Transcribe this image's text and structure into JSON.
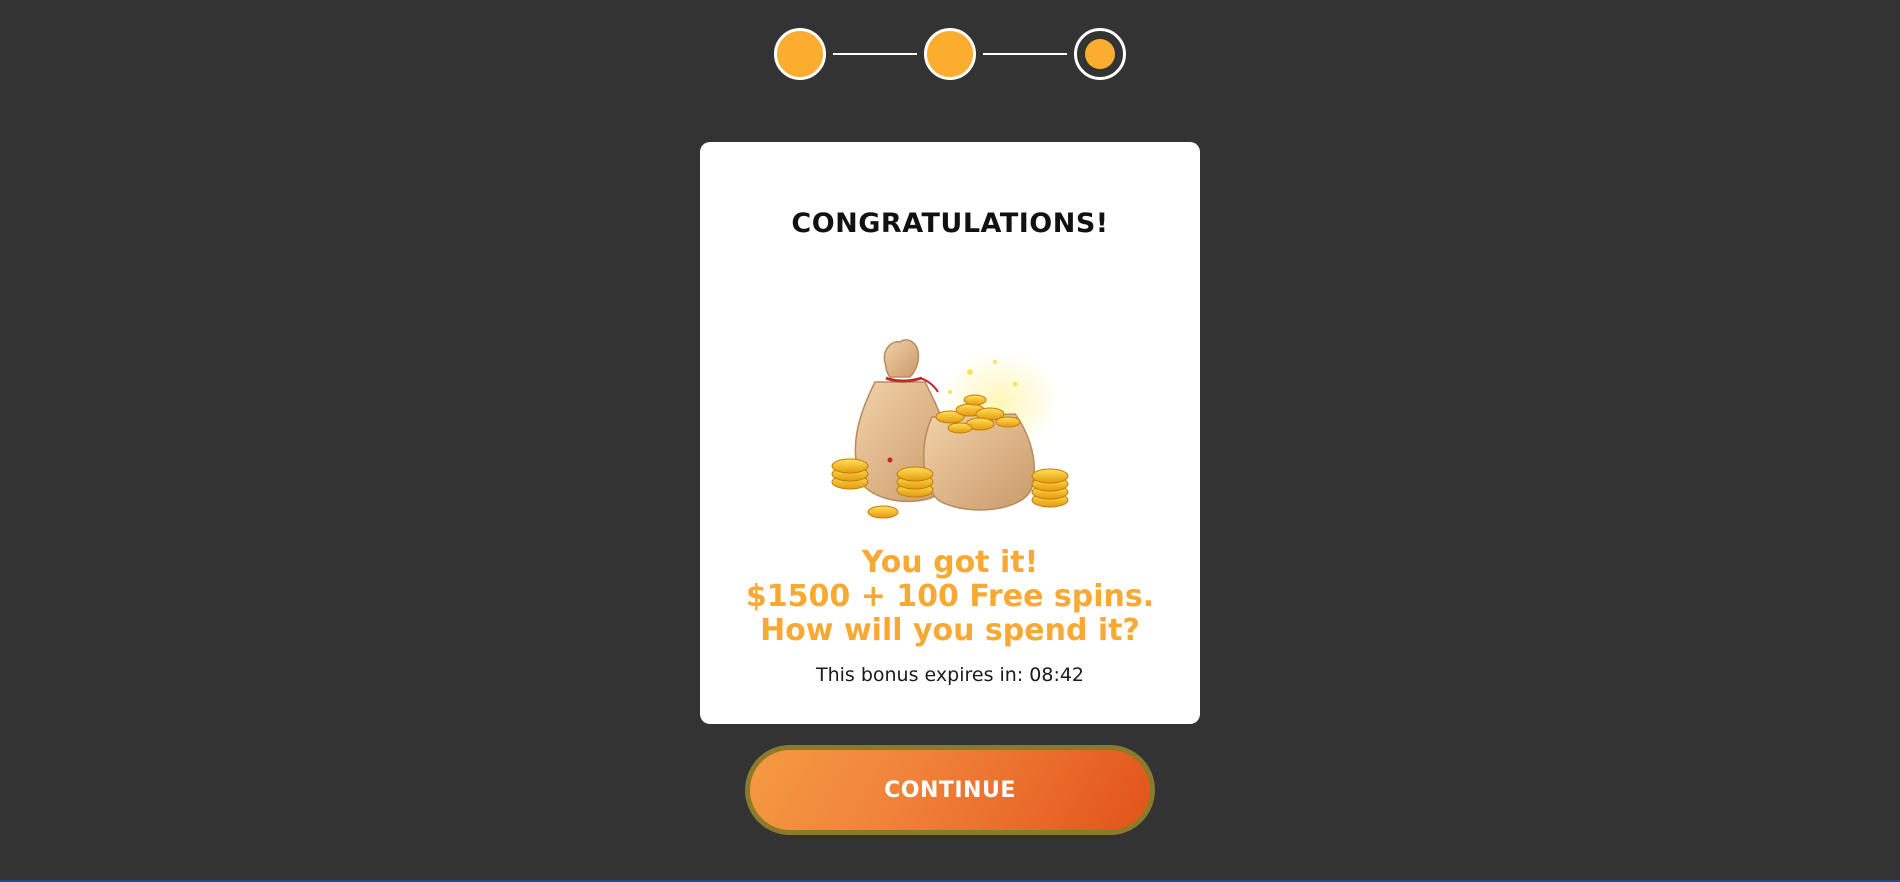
{
  "stepper": {
    "steps": [
      {
        "state": "completed"
      },
      {
        "state": "completed"
      },
      {
        "state": "current"
      }
    ],
    "accent_color": "#fbad2f"
  },
  "card": {
    "title": "CONGRATULATIONS!",
    "illustration_icon": "money-bags-with-gold-coins",
    "headline_line1": "You got it!",
    "headline_line2": "$1500 + 100 Free spins.",
    "headline_line3": "How will you spend it?",
    "expires_text": "This bonus expires in: 08:42"
  },
  "continue_label": "CONTINUE",
  "colors": {
    "background": "#333333",
    "headline": "#f8a933",
    "button_start": "#f59a42",
    "button_end": "#e2531a"
  }
}
